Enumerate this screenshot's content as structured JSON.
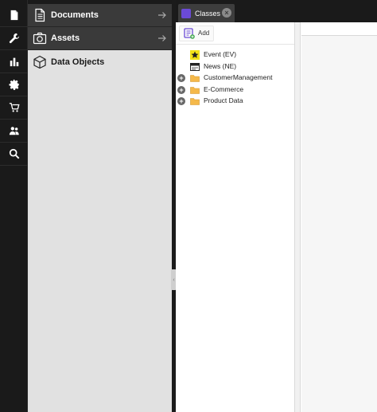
{
  "rail": {
    "items": [
      {
        "name": "documents-icon"
      },
      {
        "name": "tools-icon"
      },
      {
        "name": "reports-icon"
      },
      {
        "name": "settings-icon"
      },
      {
        "name": "ecommerce-cart-icon"
      },
      {
        "name": "users-icon"
      },
      {
        "name": "search-icon"
      }
    ]
  },
  "nav": {
    "items": [
      {
        "label": "Documents",
        "icon": "document-icon"
      },
      {
        "label": "Assets",
        "icon": "camera-icon"
      },
      {
        "label": "Data Objects",
        "icon": "cube-icon"
      }
    ]
  },
  "tabs": [
    {
      "label": "Classes",
      "icon": "classes-icon",
      "active": true
    }
  ],
  "toolbar": {
    "add_label": "Add"
  },
  "tree": [
    {
      "label": "Event (EV)",
      "icon": "star-icon",
      "expandable": false
    },
    {
      "label": "News (NE)",
      "icon": "news-icon",
      "expandable": false
    },
    {
      "label": "CustomerManagement",
      "icon": "folder-icon",
      "expandable": true
    },
    {
      "label": "E-Commerce",
      "icon": "folder-icon",
      "expandable": true
    },
    {
      "label": "Product Data",
      "icon": "folder-icon",
      "expandable": true
    }
  ],
  "colors": {
    "rail_bg": "#1a1a1a",
    "nav_dark": "#3a3a3a",
    "nav_light": "#e1e1e1",
    "tab_accent": "#6b4ad6",
    "folder": "#f5b94a",
    "star_bg": "#f3e217"
  }
}
